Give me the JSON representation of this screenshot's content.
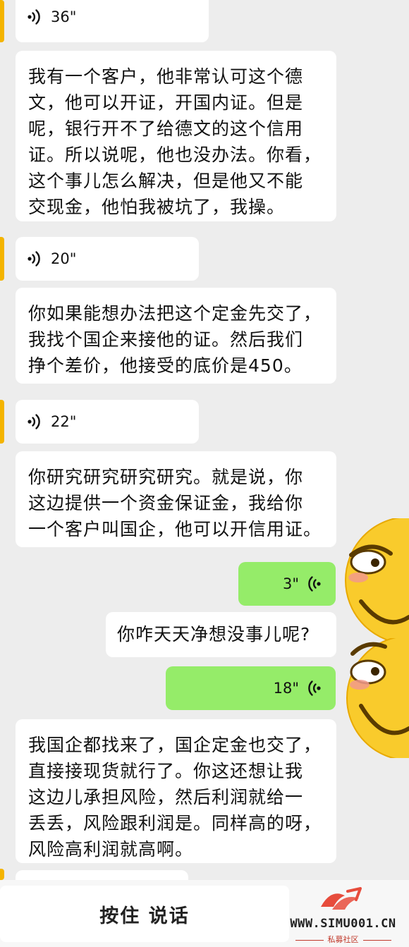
{
  "chat": {
    "messages": [
      {
        "type": "voice",
        "direction": "received",
        "duration": "36\""
      },
      {
        "type": "text",
        "direction": "received",
        "lines": [
          "我有一个客户，他非常认可这个德",
          "文，他可以开证，开国内证。但是",
          "呢，银行开不了给德文的这个信用",
          "证。所以说呢，他也没办法。你看，",
          "这个事儿怎么解决，但是他又不能",
          "交现金，他怕我被坑了，我操。"
        ]
      },
      {
        "type": "voice",
        "direction": "received",
        "duration": "20\""
      },
      {
        "type": "text",
        "direction": "received",
        "lines": [
          "你如果能想办法把这个定金先交了，",
          "我找个国企来接他的证。然后我们",
          "挣个差价，他接受的底价是450。"
        ]
      },
      {
        "type": "voice",
        "direction": "received",
        "duration": "22\""
      },
      {
        "type": "text",
        "direction": "received",
        "lines": [
          "你研究研究研究研究。就是说，你",
          "这边提供一个资金保证金，我给你",
          "一个客户叫国企，他可以开信用证。"
        ]
      },
      {
        "type": "voice",
        "direction": "sent",
        "duration": "3\""
      },
      {
        "type": "text",
        "direction": "received",
        "lines": [
          "你咋天天净想没事儿呢?"
        ]
      },
      {
        "type": "voice",
        "direction": "sent",
        "duration": "18\""
      },
      {
        "type": "text",
        "direction": "received",
        "lines": [
          "我国企都找来了，国企定金也交了，",
          "直接接现货就行了。你这还想让我",
          "这边儿承担风险，然后利润就给一",
          "丢丢，风险跟利润是。同样高的呀，",
          "风险高利润就高啊。"
        ]
      }
    ]
  },
  "input_bar": {
    "hold_to_talk_label": "按住 说话"
  },
  "watermark": {
    "url": "WWW.SIMU001.CN",
    "subtitle": "私募社区"
  },
  "colors": {
    "background": "#ededed",
    "received_bubble": "#ffffff",
    "sent_bubble": "#95ec69",
    "avatar_edge": "#f4b400",
    "watermark_accent": "#e74c3c"
  },
  "icons": {
    "voice": "voice-wave-icon",
    "sticker": "smirk-emoji-sticker",
    "logo": "simu-logo-icon"
  }
}
